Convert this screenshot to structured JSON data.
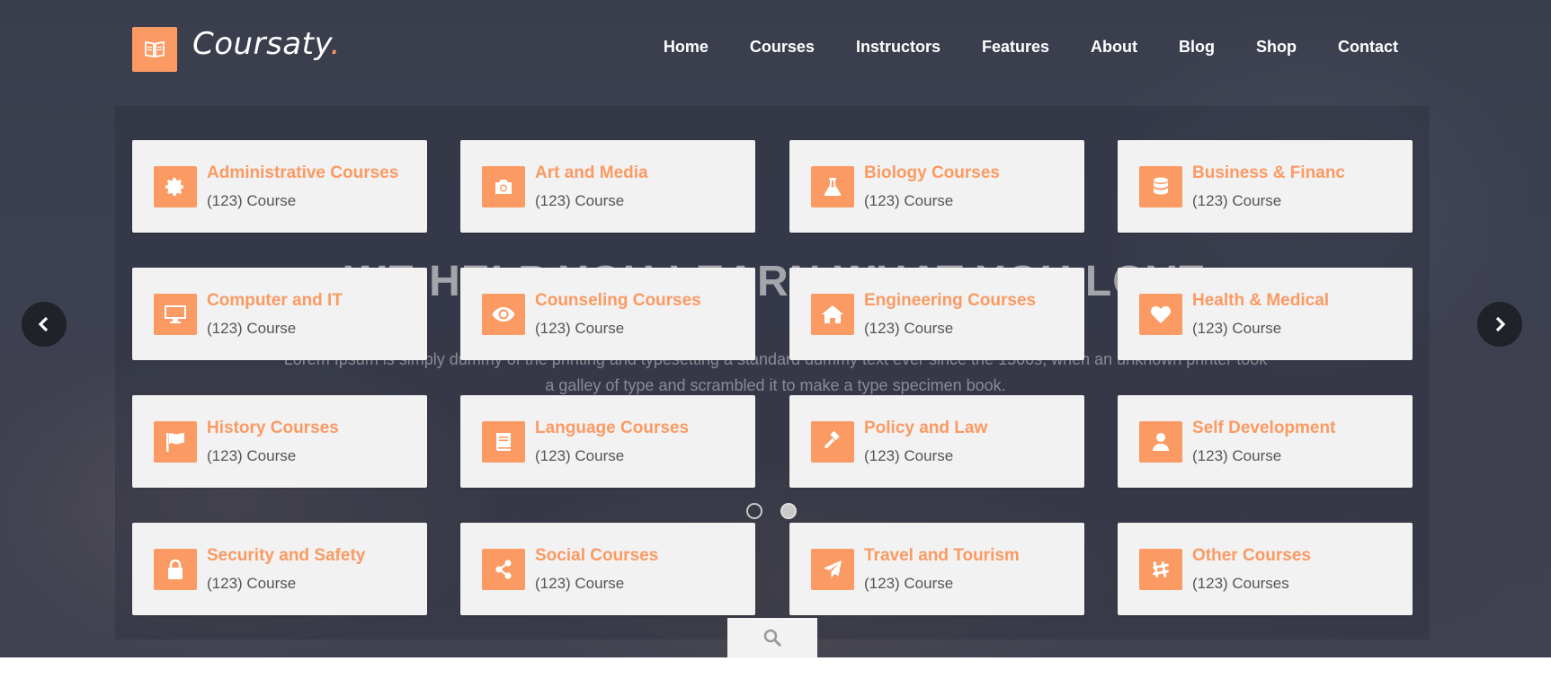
{
  "brand": {
    "name": "Coursaty",
    "dot": ".",
    "accent": "#fb9a63"
  },
  "nav": [
    "Home",
    "Courses",
    "Instructors",
    "Features",
    "About",
    "Blog",
    "Shop",
    "Contact"
  ],
  "hero": {
    "headline": "WE HELP YOU LEARN WHAT YOU LOVE",
    "paragraph_line1": "Lorem Ipsum is simply dummy of the printing and typesetting a standard dummy text ever since the 1500s, when an unknown printer took",
    "paragraph_line2": "a galley of type and scrambled it to make a type specimen book."
  },
  "categories": [
    {
      "title": "Administrative Courses",
      "count": "(123) Course",
      "icon": "gear-icon"
    },
    {
      "title": "Art and Media",
      "count": "(123) Course",
      "icon": "camera-icon"
    },
    {
      "title": "Biology Courses",
      "count": "(123) Course",
      "icon": "flask-icon"
    },
    {
      "title": "Business & Financ",
      "count": "(123) Course",
      "icon": "database-icon"
    },
    {
      "title": "Computer and IT",
      "count": "(123) Course",
      "icon": "desktop-icon"
    },
    {
      "title": "Counseling Courses",
      "count": "(123) Course",
      "icon": "eye-icon"
    },
    {
      "title": "Engineering Courses",
      "count": "(123) Course",
      "icon": "home-icon"
    },
    {
      "title": "Health & Medical",
      "count": "(123) Course",
      "icon": "heart-icon"
    },
    {
      "title": "History Courses",
      "count": "(123) Course",
      "icon": "flag-icon"
    },
    {
      "title": "Language Courses",
      "count": "(123) Course",
      "icon": "book-icon"
    },
    {
      "title": "Policy and Law",
      "count": "(123) Course",
      "icon": "gavel-icon"
    },
    {
      "title": "Self Development",
      "count": "(123) Course",
      "icon": "user-icon"
    },
    {
      "title": "Security and Safety",
      "count": "(123) Course",
      "icon": "lock-icon"
    },
    {
      "title": "Social Courses",
      "count": "(123) Course",
      "icon": "share-icon"
    },
    {
      "title": "Travel and Tourism",
      "count": "(123) Course",
      "icon": "paper-plane-icon"
    },
    {
      "title": "Other Courses",
      "count": "(123) Courses",
      "icon": "slack-icon"
    }
  ],
  "slider": {
    "active_dot": 1,
    "dot_count": 2
  }
}
